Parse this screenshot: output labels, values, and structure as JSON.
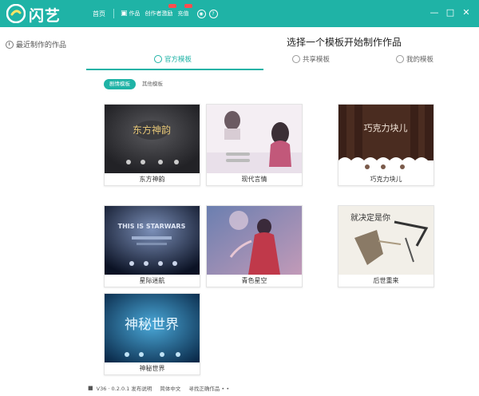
{
  "app": {
    "name": "闪艺"
  },
  "nav": {
    "home": "首页",
    "work": "作品",
    "creator_incentive": "创作者激励",
    "recharge": "充值"
  },
  "sidebar": {
    "recent_label": "最近制作的作品"
  },
  "main": {
    "title": "选择一个模板开始制作作品",
    "tabs": [
      {
        "label": "官方模板",
        "active": true
      },
      {
        "label": "共享模板"
      },
      {
        "label": "我的模板"
      }
    ],
    "filters": [
      {
        "label": "剧情模板",
        "active": true
      },
      {
        "label": "其他模板"
      }
    ]
  },
  "templates": [
    {
      "name": "东方神韵",
      "thumb_text": "东方神韵"
    },
    {
      "name": "现代言情"
    },
    {
      "name": "巧克力块儿",
      "thumb_text": "巧克力块儿"
    },
    {
      "name": "星际迷航",
      "thumb_text": "THIS IS STARWARS"
    },
    {
      "name": "青色星空"
    },
    {
      "name": "后世重来",
      "thumb_text": "就决定是你"
    },
    {
      "name": "神秘世界",
      "thumb_text": "神秘世界"
    }
  ],
  "status": {
    "version": "V36 · 0.2.0.1 发布说明",
    "action": "简体中文",
    "hint": "寻找正确作品 • •"
  },
  "colors": {
    "accent": "#1fb3a6",
    "badge": "#ff4d4f"
  }
}
